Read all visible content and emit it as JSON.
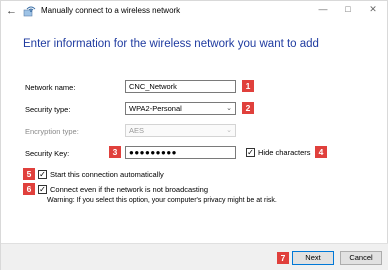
{
  "window": {
    "title": "Manually connect to a wireless network",
    "back_icon": "back-arrow-icon",
    "wifi_icon": "wifi-network-icon",
    "controls": [
      "minimize-icon",
      "maximize-icon",
      "close-icon"
    ]
  },
  "heading": "Enter information for the wireless network you want to add",
  "form": {
    "network_name": {
      "label": "Network name:",
      "value": "CNC_Network",
      "badge": "1"
    },
    "security_type": {
      "label": "Security type:",
      "value": "WPA2-Personal",
      "badge": "2"
    },
    "encryption_type": {
      "label": "Encryption type:",
      "value": "AES"
    },
    "security_key": {
      "label": "Security Key:",
      "value": "●●●●●●●●●",
      "badge": "3"
    },
    "hide_characters": {
      "label": "Hide characters",
      "checked": true,
      "badge": "4"
    },
    "start_automatically": {
      "label": "Start this connection automatically",
      "checked": true,
      "badge": "5"
    },
    "connect_not_broadcasting": {
      "label": "Connect even if the network is not broadcasting",
      "checked": true,
      "badge": "6"
    },
    "warning": "Warning: If you select this option, your computer's privacy might be at risk."
  },
  "footer": {
    "badge": "7",
    "next_label": "Next",
    "cancel_label": "Cancel"
  },
  "colors": {
    "heading": "#1f3ba0",
    "badge": "#e0403c",
    "primary_border": "#0078d7"
  }
}
